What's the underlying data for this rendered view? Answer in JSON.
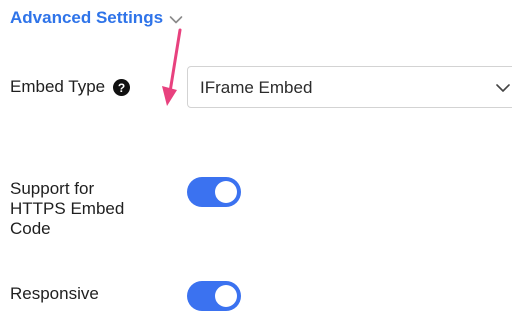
{
  "advanced_settings": {
    "title": "Advanced Settings",
    "expand_icon": "chevron-down-icon",
    "accent_color": "#2f74e9"
  },
  "annotation": {
    "icon": "arrow-down-icon",
    "color": "#e8417e"
  },
  "embed_type": {
    "label": "Embed Type",
    "help_icon": "question-circle-icon",
    "selected_value": "IFrame Embed",
    "dropdown_icon": "chevron-down-icon"
  },
  "https_support": {
    "label": "Support for HTTPS Embed Code",
    "enabled": true
  },
  "responsive": {
    "label": "Responsive",
    "enabled": true
  },
  "toggle_color": "#3b72f0"
}
